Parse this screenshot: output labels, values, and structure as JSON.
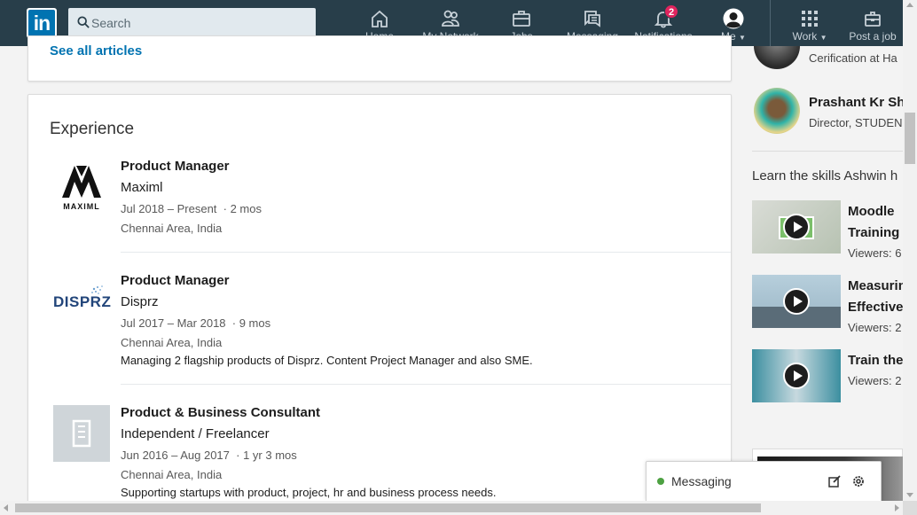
{
  "nav": {
    "search_placeholder": "Search",
    "items": [
      {
        "label": "Home",
        "icon": "home-icon"
      },
      {
        "label": "My Network",
        "icon": "people-icon"
      },
      {
        "label": "Jobs",
        "icon": "briefcase-icon"
      },
      {
        "label": "Messaging",
        "icon": "messaging-icon"
      },
      {
        "label": "Notifications",
        "icon": "bell-icon",
        "badge": "2"
      },
      {
        "label": "Me",
        "icon": "avatar"
      },
      {
        "label": "Work",
        "icon": "grid-icon"
      },
      {
        "label": "Post a job",
        "icon": "post-job-icon"
      }
    ],
    "logo_text": "in"
  },
  "articles": {
    "see_all": "See all articles"
  },
  "experience": {
    "title": "Experience",
    "jobs": [
      {
        "title": "Product Manager",
        "company": "Maximl",
        "dates": "Jul 2018 – Present",
        "duration": "2 mos",
        "location": "Chennai Area, India",
        "description": "",
        "logo": "MAXIML"
      },
      {
        "title": "Product Manager",
        "company": "Disprz",
        "dates": "Jul 2017 – Mar 2018",
        "duration": "9 mos",
        "location": "Chennai Area, India",
        "description": "Managing 2 flagship products of Disprz. Content Project Manager and also SME.",
        "logo": "DISPRZ"
      },
      {
        "title": "Product & Business Consultant",
        "company": "Independent / Freelancer",
        "dates": "Jun 2016 – Aug 2017",
        "duration": "1 yr 3 mos",
        "location": "Chennai Area, India",
        "description": "Supporting startups with product, project, hr and business process needs.",
        "logo": ""
      }
    ]
  },
  "rail": {
    "people": [
      {
        "name": "",
        "headline": "Cerification at Ha"
      },
      {
        "name": "Prashant Kr Sh",
        "headline": "Director, STUDEN"
      }
    ],
    "learn_heading": "Learn the skills Ashwin h",
    "courses": [
      {
        "title_line1": "Moodle",
        "title_line2": "Training",
        "viewers": "Viewers: 6"
      },
      {
        "title_line1": "Measurin",
        "title_line2": "Effective",
        "viewers": "Viewers: 2"
      },
      {
        "title_line1": "Train the",
        "title_line2": "",
        "viewers": "Viewers: 2"
      }
    ]
  },
  "messaging_dock": {
    "label": "Messaging",
    "status_color": "#4da142"
  },
  "colors": {
    "nav_bg": "#283e4a",
    "brand": "#0073b1",
    "badge": "#e0245e"
  }
}
